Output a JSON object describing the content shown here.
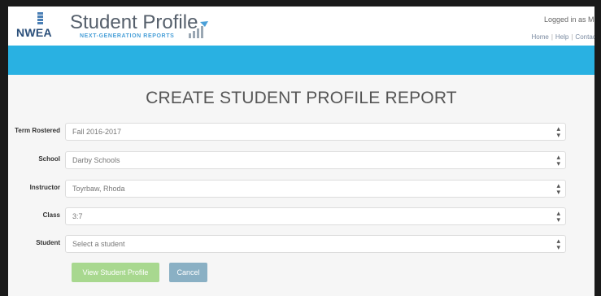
{
  "header": {
    "logo_text": "NWEA",
    "app_title": "Student Profile",
    "app_subtitle": "NEXT-GENERATION REPORTS",
    "logged_in_text": "Logged in as Ms",
    "links": [
      "Home",
      "Help",
      "Contact"
    ]
  },
  "main": {
    "title": "CREATE STUDENT PROFILE REPORT",
    "fields": [
      {
        "label": "Term Rostered",
        "value": "Fall 2016-2017"
      },
      {
        "label": "School",
        "value": "Darby Schools"
      },
      {
        "label": "Instructor",
        "value": "Toyrbaw, Rhoda"
      },
      {
        "label": "Class",
        "value": "3:7"
      },
      {
        "label": "Student",
        "value": "Select a student"
      }
    ],
    "view_button": "View Student Profile",
    "cancel_button": "Cancel"
  },
  "colors": {
    "band": "#29b1e2",
    "view_button": "#a8d88f",
    "cancel_button": "#8ab0c4"
  },
  "icons": {
    "logo": "nwea-logo-icon",
    "chart": "bar-chart-icon",
    "select": "select-arrows-icon"
  }
}
